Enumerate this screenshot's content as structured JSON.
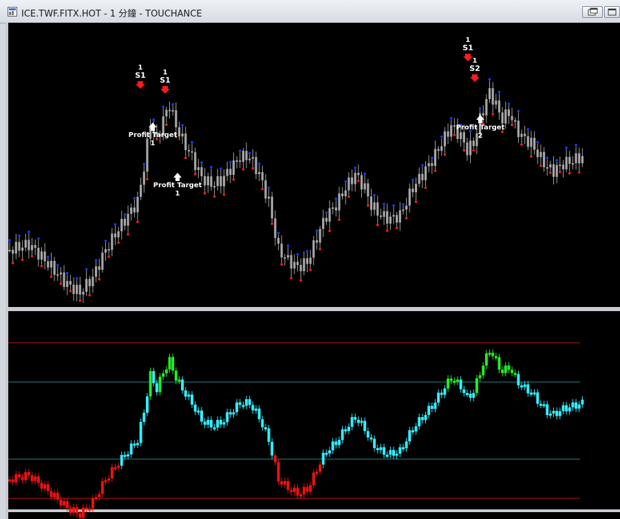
{
  "window": {
    "title": "ICE.TWF.FITX.HOT - 1 分鐘 - TOUCHANCE",
    "buttons": [
      "restore-chart-button",
      "maximize-button"
    ]
  },
  "colors": {
    "background": "#000000",
    "price_bar": "#a8a8a8",
    "dot_high": "#1a3cff",
    "dot_low": "#ff2020",
    "signal_arrow": "#ff1a1a",
    "target_arrow": "#ffffff",
    "osc_up": "#22ee22",
    "osc_mid": "#33eeff",
    "osc_down": "#ee1111",
    "line_red": "#cc1111",
    "line_teal": "#1f8a8a"
  },
  "price_panel": {
    "sell_signals": [
      {
        "count": "1",
        "label": "S1"
      },
      {
        "count": "1",
        "label": "S1"
      },
      {
        "count": "1",
        "label": "S1"
      },
      {
        "count": "1",
        "label": "S2"
      }
    ],
    "profit_targets": [
      {
        "label": "Profit Target",
        "count": "1"
      },
      {
        "label": "Profit Target",
        "count": "1"
      },
      {
        "label": "Profit Target",
        "count": "2"
      }
    ]
  },
  "oscillator_panel": {
    "levels": [
      "upper-red",
      "upper-teal",
      "lower-teal",
      "lower-red"
    ]
  }
}
